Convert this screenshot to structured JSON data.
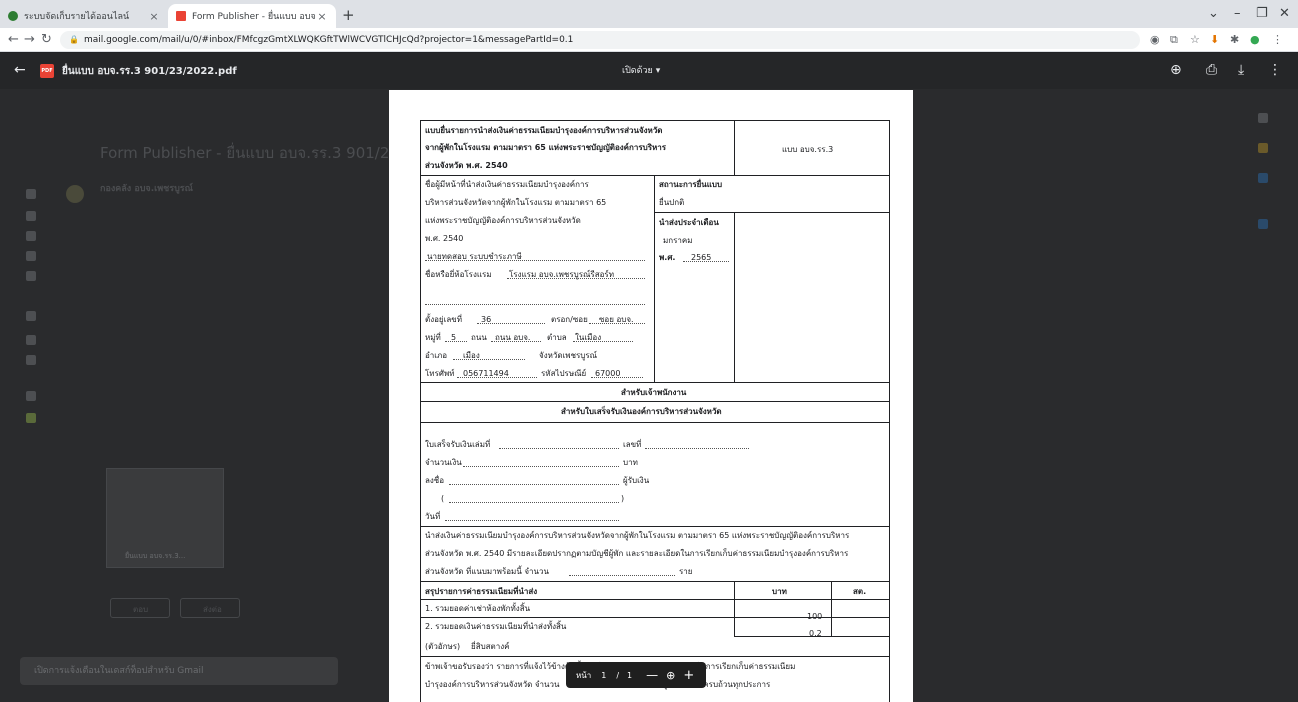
{
  "browser": {
    "tabs": [
      {
        "title": "ระบบจัดเก็บรายได้ออนไลน์",
        "active": false
      },
      {
        "title": "Form Publisher - ยื่นแบบ อบจ.รร.3",
        "active": true
      }
    ],
    "url": "mail.google.com/mail/u/0/#inbox/FMfcgzGmtXLWQKGftTWlWCVGTlCHJcQd?projector=1&messagePartId=0.1"
  },
  "gmail": {
    "subject": "Form Publisher - ยื่นแบบ อบจ.รร.3 901/23/20",
    "sender": "กองคลัง อบจ.เพชรบูรณ์",
    "attachment_name": "ยื่นแบบ อบจ.รร.3...",
    "toast_text": "เปิดการแจ้งเตือนในเดสก์ท็อปสำหรับ Gmail",
    "reply_label": "ตอบ",
    "forward_label": "ส่งต่อ"
  },
  "viewer": {
    "file_title": "ยื่นแบบ อบจ.รร.3 901/23/2022.pdf",
    "open_with_label": "เปิดด้วย",
    "page_label": "หน้า",
    "page_current": "1",
    "page_sep": "/",
    "page_total": "1"
  },
  "form": {
    "title_line1": "แบบยื่นรายการนำส่งเงินค่าธรรมเนียมบำรุงองค์การบริหารส่วนจังหวัด",
    "title_line2": "จากผู้พักในโรงแรม ตามมาตรา 65 แห่งพระราชบัญญัติองค์การบริหาร",
    "title_line3": "ส่วนจังหวัด พ.ศ. 2540",
    "form_code": "แบบ อบจ.รร.3",
    "desc_line1": "ชื่อผู้มีหน้าที่นำส่งเงินค่าธรรมเนียมบำรุงองค์การ",
    "desc_line2": "บริหารส่วนจังหวัดจากผู้พักในโรงแรม ตามมาตรา 65",
    "desc_line3": "แห่งพระราชบัญญัติองค์การบริหารส่วนจังหวัด",
    "desc_line4": "พ.ศ. 2540",
    "filer_name": "นายทดสอบ ระบบชำระภาษี",
    "hotel_label": "ชื่อหรือยี่ห้อโรงแรม",
    "hotel_name": "โรงแรม อบจ.เพชรบูรณ์รีสอร์ท",
    "status_label": "สถานะการยื่นแบบ",
    "status_value": "ยื่นปกติ",
    "month_label": "นำส่งประจำเดือน",
    "month_value": "มกราคม",
    "year_label": "พ.ศ.",
    "year_value": "2565",
    "addr_no_label": "ตั้งอยู่เลขที่",
    "addr_no": "36",
    "alley_label": "ตรอก/ซอย",
    "alley": "ซอย อบจ.",
    "moo_label": "หมู่ที่",
    "moo": "5",
    "road_label": "ถนน",
    "road": "ถนน อบจ.",
    "subdistrict_label": "ตำบล",
    "subdistrict": "ในเมือง",
    "district_label": "อำเภอ",
    "district": "เมือง",
    "province_label": "จังหวัดเพชรบูรณ์",
    "phone_label": "โทรศัพท์",
    "phone": "056711494",
    "postcode_label": "รหัสไปรษณีย์",
    "postcode": "67000",
    "officer_header": "สำหรับเจ้าพนักงาน",
    "receipt_header": "สำหรับใบเสร็จรับเงินองค์การบริหารส่วนจังหวัด",
    "receipt_book_label": "ใบเสร็จรับเงินเล่มที่",
    "receipt_no_label": "เลขที่",
    "amount_label": "จำนวนเงิน",
    "baht_label": "บาท",
    "sign_label": "ลงชื่อ",
    "receiver_label": "ผู้รับเงิน",
    "paren_open": "(",
    "paren_close": ")",
    "date_label": "วันที่",
    "remit_line1": "นำส่งเงินค่าธรรมเนียมบำรุงองค์การบริหารส่วนจังหวัดจากผู้พักในโรงแรม ตามมาตรา 65 แห่งพระราชบัญญัติองค์การบริหาร",
    "remit_line2": "ส่วนจังหวัด พ.ศ. 2540 มีรายละเอียดปรากฏตามบัญชีผู้พัก และรายละเอียดในการเรียกเก็บค่าธรรมเนียมบำรุงองค์การบริหาร",
    "remit_line3": "ส่วนจังหวัด ที่แนบมาพร้อมนี้ จำนวน",
    "items_label": "ราย",
    "summary_header": "สรุปรายการค่าธรรมเนียมที่นำส่ง",
    "col_baht": "บาท",
    "col_satang": "สต.",
    "row1_label": "1. รวมยอดค่าเช่าห้องพักทั้งสิ้น",
    "row1_baht": "100",
    "row2_label": "2. รวมยอดเงินค่าธรรมเนียมที่นำส่งทั้งสิ้น",
    "row2_baht": "0.2",
    "words_label": "(ตัวอักษร)",
    "words_value": "ยี่สิบสตางค์",
    "certify_line1": "ข้าพเจ้าขอรับรองว่า รายการที่แจ้งไว้ข้างต้นนี้ และในบัญชีผู้พัก และรายละเอียดในการเรียกเก็บค่าธรรมเนียม",
    "certify_line2": "บำรุงองค์การบริหารส่วนจังหวัด จำนวน",
    "certify_line2b": "ฉบับ เป็นรายการที่ถูกต้อง และครบถ้วนทุกประการ"
  }
}
